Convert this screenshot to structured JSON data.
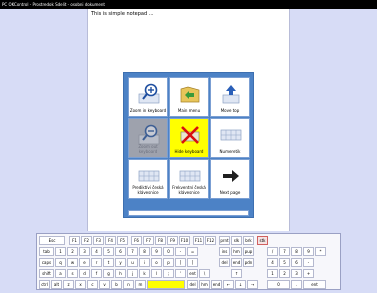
{
  "window": {
    "title": "PC OKControl - Prostredok Sdelit - osobni dokument"
  },
  "document": {
    "text": "This is simple notepad ..."
  },
  "tiles": [
    {
      "label": "Zoom in keyboard",
      "icon": "zoom-in-icon"
    },
    {
      "label": "Main menu",
      "icon": "menu-folder-icon"
    },
    {
      "label": "Move top",
      "icon": "move-top-icon"
    },
    {
      "label": "Zoom out keyboard",
      "icon": "zoom-out-icon"
    },
    {
      "label": "Hide keyboard",
      "icon": "hide-keyboard-icon"
    },
    {
      "label": "Numeretik",
      "icon": "numeric-keyboard-icon"
    },
    {
      "label": "Prediktívi česká klávesnice",
      "icon": "predictive-keyboard-icon"
    },
    {
      "label": "Frekventní česká klávesnice",
      "icon": "frequency-keyboard-icon"
    },
    {
      "label": "Next page",
      "icon": "next-page-arrow-icon"
    }
  ],
  "keyboard": {
    "rows": [
      [
        "Esc",
        "F1",
        "F2",
        "F3",
        "F4",
        "F5",
        "F6",
        "F7",
        "F8",
        "F9",
        "F10",
        "F11",
        "F12",
        "prnt",
        "slk",
        "brk",
        "stk"
      ],
      [
        "tab",
        "1",
        "2",
        "3",
        "4",
        "5",
        "6",
        "7",
        "8",
        "9",
        "0",
        "-",
        "=",
        "ins",
        "hm",
        "pup",
        "/",
        "7",
        "8",
        "9",
        "*"
      ],
      [
        "caps",
        "q",
        "w",
        "e",
        "r",
        "t",
        "y",
        "u",
        "i",
        "o",
        "p",
        "[",
        "]",
        "del",
        "end",
        "pdn",
        "4",
        "5",
        "6",
        "-"
      ],
      [
        "shift",
        "a",
        "s",
        "d",
        "f",
        "g",
        "h",
        "j",
        "k",
        "l",
        ";",
        "'",
        "ent",
        "\\",
        "↑",
        "1",
        "2",
        "3",
        "+"
      ],
      [
        "ctrl",
        "alt",
        "z",
        "x",
        "c",
        "v",
        "b",
        "n",
        "m",
        "",
        "del",
        "hm",
        "end",
        "←",
        "↓",
        "→",
        "0",
        ".",
        "ent"
      ]
    ]
  }
}
